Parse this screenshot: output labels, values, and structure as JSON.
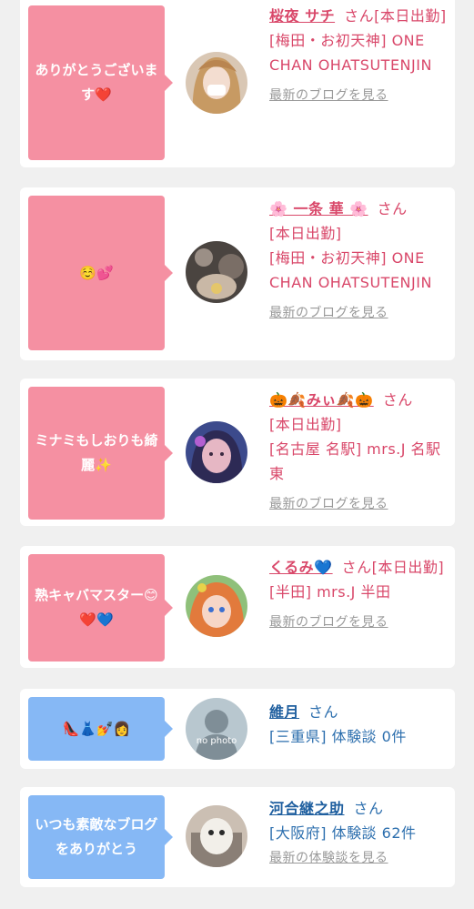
{
  "cards": [
    {
      "message": "ありがとうございます❤️",
      "name": "桜夜 サチ",
      "honorific": "さん",
      "status": "[本日出勤]",
      "location": "[梅田・お初天神] ONE CHAN OHATSUTENJIN",
      "link": "最新のブログを見る",
      "theme": "pink"
    },
    {
      "message": "☺️💕",
      "name": "🌸 一条 華 🌸",
      "honorific": "さん",
      "status": "[本日出勤]",
      "location": "[梅田・お初天神] ONE CHAN OHATSUTENJIN",
      "link": "最新のブログを見る",
      "theme": "pink"
    },
    {
      "message": "ミナミもしおりも綺麗✨",
      "name": "🎃🍂みぃ🍂🎃",
      "honorific": "さん",
      "status": "[本日出勤]",
      "location": "[名古屋 名駅] mrs.J 名駅東",
      "link": "最新のブログを見る",
      "theme": "pink"
    },
    {
      "message": "熟キャバマスター😊❤️💙",
      "name": "くるみ💙",
      "honorific": "さん",
      "status": "[本日出勤]",
      "location": "[半田] mrs.J 半田",
      "link": "最新のブログを見る",
      "theme": "pink"
    },
    {
      "message": "👠👗💅👩",
      "name": "維月",
      "honorific": "さん",
      "location": "[三重県] 体験談 0件",
      "avatar_label": "no photo",
      "theme": "blue"
    },
    {
      "message": "いつも素敵なブログをありがとう",
      "name": "河合継之助",
      "honorific": "さん",
      "location": "[大阪府] 体験談 62件",
      "link": "最新の体験談を見る",
      "theme": "blue"
    }
  ]
}
